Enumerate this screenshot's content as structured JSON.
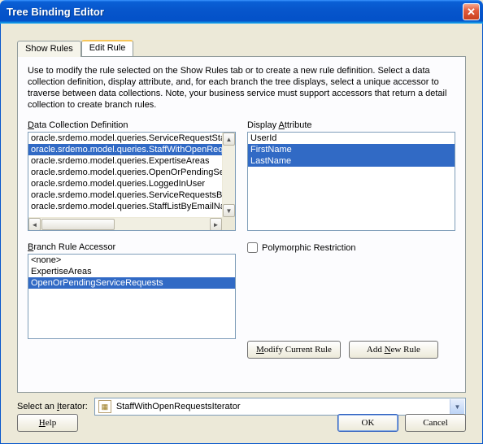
{
  "window": {
    "title": "Tree Binding Editor"
  },
  "tabs": {
    "show_rules": "Show Rules",
    "edit_rule": "Edit Rule"
  },
  "intro": "Use to modify the rule selected on the Show Rules tab or to create a new rule definition. Select a data collection definition, display attribute, and, for each branch the tree displays, select a unique accessor to traverse between data collections. Note, your business service must support accessors that return a detail collection to create branch rules.",
  "labels": {
    "data_collection": "Data Collection Definition",
    "display_attribute": "Display Attribute",
    "branch_rule": "Branch Rule Accessor",
    "polymorphic": "Polymorphic Restriction",
    "modify_current": "Modify Current Rule",
    "add_new": "Add New Rule",
    "select_iterator": "Select an Iterator:",
    "help": "Help",
    "ok": "OK",
    "cancel": "Cancel"
  },
  "data_collection": {
    "items": [
      "oracle.srdemo.model.queries.ServiceRequestStatus",
      "oracle.srdemo.model.queries.StaffWithOpenRequests",
      "oracle.srdemo.model.queries.ExpertiseAreas",
      "oracle.srdemo.model.queries.OpenOrPendingServiceRequests",
      "oracle.srdemo.model.queries.LoggedInUser",
      "oracle.srdemo.model.queries.ServiceRequestsByStatus",
      "oracle.srdemo.model.queries.StaffListByEmailNameRole"
    ],
    "selected_index": 1
  },
  "display_attribute": {
    "items": [
      "UserId",
      "FirstName",
      "LastName"
    ],
    "selected_indices": [
      1,
      2
    ]
  },
  "branch_rule": {
    "items": [
      "<none>",
      "ExpertiseAreas",
      "OpenOrPendingServiceRequests"
    ],
    "selected_index": 2
  },
  "polymorphic_checked": false,
  "iterator": {
    "value": "StaffWithOpenRequestsIterator"
  }
}
